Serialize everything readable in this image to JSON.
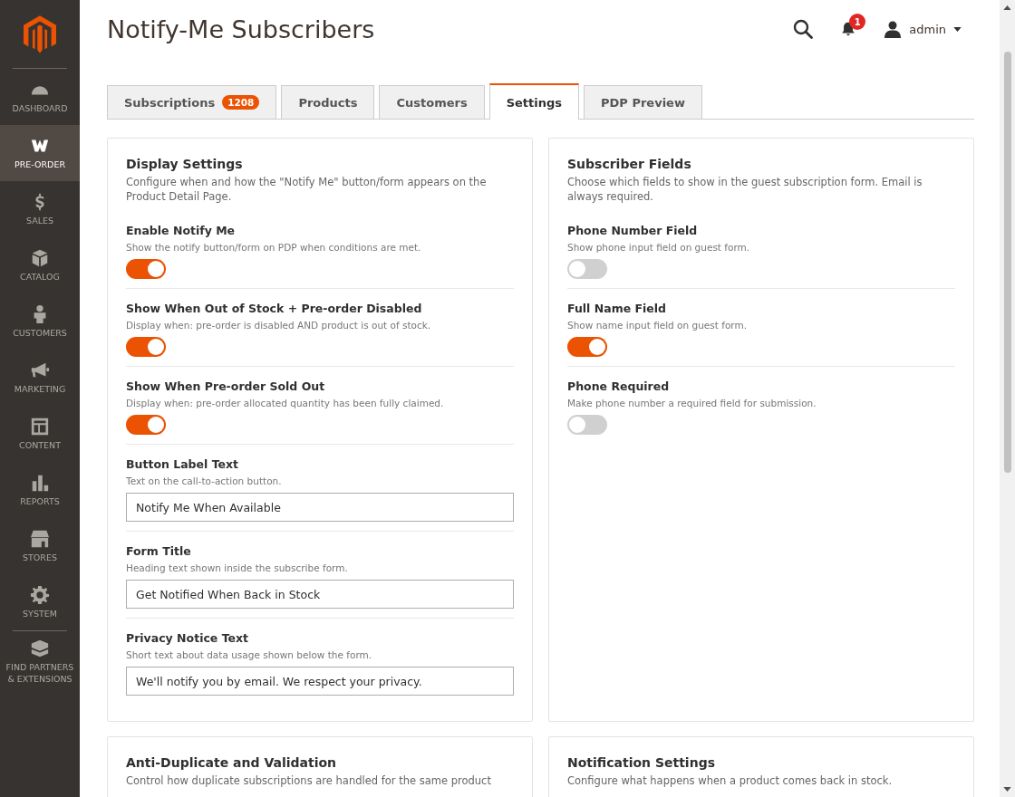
{
  "sidebar": {
    "items": [
      {
        "label": "DASHBOARD",
        "selected": false
      },
      {
        "label": "PRE-ORDER",
        "selected": true
      },
      {
        "label": "SALES",
        "selected": false
      },
      {
        "label": "CATALOG",
        "selected": false
      },
      {
        "label": "CUSTOMERS",
        "selected": false
      },
      {
        "label": "MARKETING",
        "selected": false
      },
      {
        "label": "CONTENT",
        "selected": false
      },
      {
        "label": "REPORTS",
        "selected": false
      },
      {
        "label": "STORES",
        "selected": false
      },
      {
        "label": "SYSTEM",
        "selected": false
      },
      {
        "label": "FIND PARTNERS & EXTENSIONS",
        "selected": false
      }
    ]
  },
  "header": {
    "title": "Notify-Me Subscribers",
    "notification_count": "1",
    "user": "admin"
  },
  "tabs": [
    {
      "label": "Subscriptions",
      "badge": "1208",
      "selected": false
    },
    {
      "label": "Products",
      "selected": false
    },
    {
      "label": "Customers",
      "selected": false
    },
    {
      "label": "Settings",
      "selected": true
    },
    {
      "label": "PDP Preview",
      "selected": false
    }
  ],
  "cards": [
    {
      "title": "Display Settings",
      "description": "Configure when and how the \"Notify Me\" button/form appears on the Product Detail Page.",
      "settings": [
        {
          "kind": "toggle",
          "label": "Enable Notify Me",
          "description": "Show the notify button/form on PDP when conditions are met.",
          "on": true
        },
        {
          "kind": "toggle",
          "label": "Show When Out of Stock + Pre-order Disabled",
          "description": "Display when: pre-order is disabled AND product is out of stock.",
          "on": true
        },
        {
          "kind": "toggle",
          "label": "Show When Pre-order Sold Out",
          "description": "Display when: pre-order allocated quantity has been fully claimed.",
          "on": true
        },
        {
          "kind": "text",
          "label": "Button Label Text",
          "description": "Text on the call-to-action button.",
          "value": "Notify Me When Available"
        },
        {
          "kind": "text",
          "label": "Form Title",
          "description": "Heading text shown inside the subscribe form.",
          "value": "Get Notified When Back in Stock"
        },
        {
          "kind": "text",
          "label": "Privacy Notice Text",
          "description": "Short text about data usage shown below the form.",
          "value": "We'll notify you by email. We respect your privacy."
        }
      ]
    },
    {
      "title": "Subscriber Fields",
      "description": "Choose which fields to show in the guest subscription form. Email is always required.",
      "settings": [
        {
          "kind": "toggle",
          "label": "Phone Number Field",
          "description": "Show phone input field on guest form.",
          "on": false
        },
        {
          "kind": "toggle",
          "label": "Full Name Field",
          "description": "Show name input field on guest form.",
          "on": true
        },
        {
          "kind": "toggle",
          "label": "Phone Required",
          "description": "Make phone number a required field for submission.",
          "on": false
        }
      ]
    },
    {
      "title": "Anti-Duplicate and Validation",
      "description": "Control how duplicate subscriptions are handled for the same product"
    },
    {
      "title": "Notification Settings",
      "description": "Configure what happens when a product comes back in stock."
    }
  ]
}
